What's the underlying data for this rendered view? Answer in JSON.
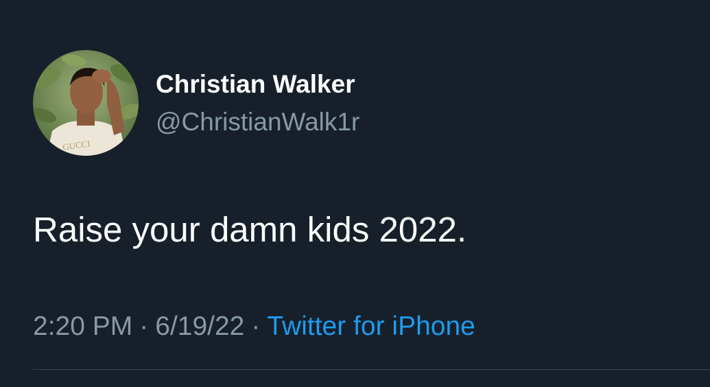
{
  "tweet": {
    "author": {
      "display_name": "Christian Walker",
      "handle": "@ChristianWalk1r",
      "avatar_icon": "profile-photo-avatar",
      "avatar_shirt_text": "GUCCI"
    },
    "text": "Raise your damn kids 2022.",
    "time": "2:20 PM",
    "separator": "·",
    "date": "6/19/22",
    "source": "Twitter for iPhone"
  },
  "colors": {
    "background": "#17202a",
    "primary_text": "#ffffff",
    "secondary_text": "#8899a6",
    "link": "#1d9bf0",
    "divider": "#38444d"
  }
}
